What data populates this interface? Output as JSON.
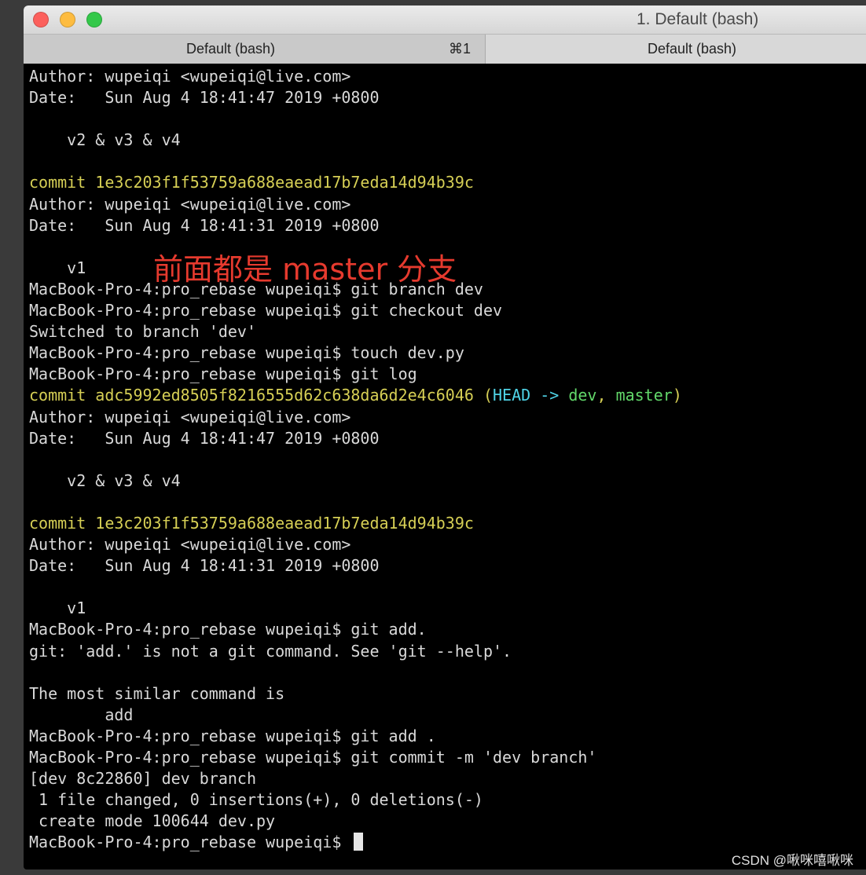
{
  "window": {
    "title": "1. Default (bash)",
    "controls": {
      "close_color": "#fc605c",
      "minimize_color": "#fdbc40",
      "zoom_color": "#34c84a"
    }
  },
  "tabs": [
    {
      "label": "Default (bash)",
      "shortcut": "⌘1"
    },
    {
      "label": "Default (bash)"
    }
  ],
  "terminal": {
    "lines": [
      "Author: wupeiqi <wupeiqi@live.com>",
      "Date:   Sun Aug 4 18:41:47 2019 +0800",
      "",
      "    v2 & v3 & v4",
      "",
      "commit 1e3c203f1f53759a688eaead17b7eda14d94b39c",
      "Author: wupeiqi <wupeiqi@live.com>",
      "Date:   Sun Aug 4 18:41:31 2019 +0800",
      "",
      "    v1",
      "MacBook-Pro-4:pro_rebase wupeiqi$ git branch dev",
      "MacBook-Pro-4:pro_rebase wupeiqi$ git checkout dev",
      "Switched to branch 'dev'",
      "MacBook-Pro-4:pro_rebase wupeiqi$ touch dev.py",
      "MacBook-Pro-4:pro_rebase wupeiqi$ git log",
      "commit adc5992ed8505f8216555d62c638da6d2e4c6046 ",
      "Author: wupeiqi <wupeiqi@live.com>",
      "Date:   Sun Aug 4 18:41:47 2019 +0800",
      "",
      "    v2 & v3 & v4",
      "",
      "commit 1e3c203f1f53759a688eaead17b7eda14d94b39c",
      "Author: wupeiqi <wupeiqi@live.com>",
      "Date:   Sun Aug 4 18:41:31 2019 +0800",
      "",
      "    v1",
      "MacBook-Pro-4:pro_rebase wupeiqi$ git add.",
      "git: 'add.' is not a git command. See 'git --help'.",
      "",
      "The most similar command is",
      "        add",
      "MacBook-Pro-4:pro_rebase wupeiqi$ git add .",
      "MacBook-Pro-4:pro_rebase wupeiqi$ git commit -m 'dev branch'",
      "[dev 8c22860] dev branch",
      " 1 file changed, 0 insertions(+), 0 deletions(-)",
      " create mode 100644 dev.py",
      "MacBook-Pro-4:pro_rebase wupeiqi$ "
    ],
    "yellow_lines": [
      5,
      15,
      21
    ],
    "decoration": {
      "line": 15,
      "parts": [
        {
          "text": "(",
          "color": "yellow"
        },
        {
          "text": "HEAD -> ",
          "color": "cyan"
        },
        {
          "text": "dev",
          "color": "green"
        },
        {
          "text": ", ",
          "color": "yellow"
        },
        {
          "text": "master",
          "color": "green"
        },
        {
          "text": ")",
          "color": "yellow"
        }
      ]
    },
    "cursor_line": 36
  },
  "annotation": "前面都是 master 分支",
  "watermark": "CSDN @啾咪嘻啾咪"
}
